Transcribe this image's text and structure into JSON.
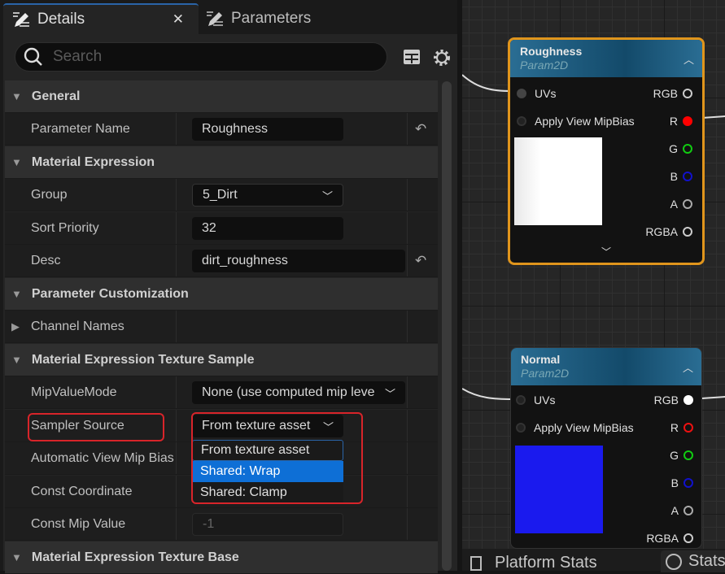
{
  "tabs": {
    "details": "Details",
    "parameters": "Parameters"
  },
  "search": {
    "placeholder": "Search"
  },
  "rows": {
    "general": "General",
    "parameter_name": "Parameter Name",
    "parameter_name_value": "Roughness",
    "material_expression": "Material Expression",
    "group": "Group",
    "group_value": "5_Dirt",
    "sort_priority": "Sort Priority",
    "sort_priority_value": "32",
    "desc": "Desc",
    "desc_value": "dirt_roughness",
    "parameter_customization": "Parameter Customization",
    "channel_names": "Channel Names",
    "texture_sample": "Material Expression Texture Sample",
    "mip_value_mode": "MipValueMode",
    "mip_value_mode_value": "None (use computed mip leve",
    "sampler_source": "Sampler Source",
    "sampler_source_value": "From texture asset",
    "auto_view_mip_bias": "Automatic View Mip Bias",
    "const_coordinate": "Const Coordinate",
    "const_mip_value": "Const Mip Value",
    "const_mip_value_value": "-1",
    "texture_base": "Material Expression Texture Base"
  },
  "sampler_options": [
    "From texture asset",
    "Shared: Wrap",
    "Shared: Clamp"
  ],
  "nodes": [
    {
      "title": "Roughness",
      "subtitle": "Param2D",
      "inputs": [
        "UVs",
        "Apply View MipBias"
      ],
      "outputs": [
        "RGB",
        "R",
        "G",
        "B",
        "A",
        "RGBA"
      ],
      "preview": "#ffffff"
    },
    {
      "title": "Normal",
      "subtitle": "Param2D",
      "inputs": [
        "UVs",
        "Apply View MipBias"
      ],
      "outputs": [
        "RGB",
        "R",
        "G",
        "B",
        "A",
        "RGBA"
      ],
      "preview": "#1a1aee"
    }
  ],
  "bottom_tabs": {
    "platform_stats": "Platform Stats",
    "stats": "Stats"
  }
}
